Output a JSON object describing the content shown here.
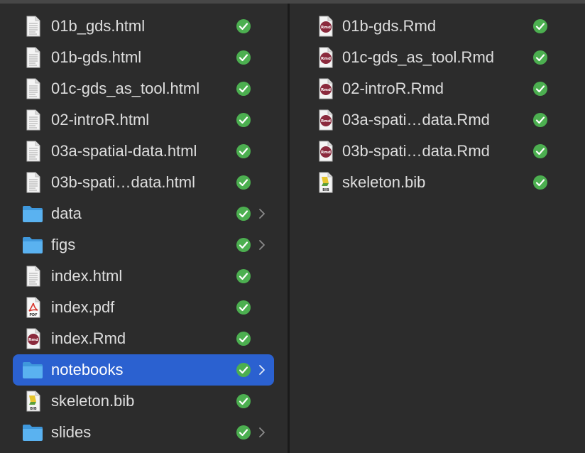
{
  "column1": {
    "items": [
      {
        "name": "01b_gds.html",
        "icon": "html-file-icon"
      },
      {
        "name": "01b-gds.html",
        "icon": "html-file-icon"
      },
      {
        "name": "01c-gds_as_tool.html",
        "icon": "html-file-icon"
      },
      {
        "name": "02-introR.html",
        "icon": "html-file-icon"
      },
      {
        "name": "03a-spatial-data.html",
        "icon": "html-file-icon"
      },
      {
        "name": "03b-spati…data.html",
        "icon": "html-file-icon"
      },
      {
        "name": "data",
        "icon": "folder-icon"
      },
      {
        "name": "figs",
        "icon": "folder-icon"
      },
      {
        "name": "index.html",
        "icon": "html-file-icon"
      },
      {
        "name": "index.pdf",
        "icon": "pdf-file-icon",
        "icon_label": "PDF"
      },
      {
        "name": "index.Rmd",
        "icon": "rmd-file-icon",
        "icon_label": "Rmd"
      },
      {
        "name": "notebooks",
        "icon": "folder-icon",
        "selected": true
      },
      {
        "name": "skeleton.bib",
        "icon": "bib-file-icon",
        "icon_label": "BIB"
      },
      {
        "name": "slides",
        "icon": "folder-icon"
      }
    ]
  },
  "column2": {
    "items": [
      {
        "name": "01b-gds.Rmd",
        "icon": "rmd-file-icon",
        "icon_label": "Rmd"
      },
      {
        "name": "01c-gds_as_tool.Rmd",
        "icon": "rmd-file-icon",
        "icon_label": "Rmd"
      },
      {
        "name": "02-introR.Rmd",
        "icon": "rmd-file-icon",
        "icon_label": "Rmd"
      },
      {
        "name": "03a-spati…data.Rmd",
        "icon": "rmd-file-icon",
        "icon_label": "Rmd"
      },
      {
        "name": "03b-spati…data.Rmd",
        "icon": "rmd-file-icon",
        "icon_label": "Rmd"
      },
      {
        "name": "skeleton.bib",
        "icon": "bib-file-icon",
        "icon_label": "BIB"
      }
    ]
  },
  "colors": {
    "background": "#2c2c2c",
    "selection": "#2b61d0",
    "sync_check": "#4caf50",
    "folder": "#4aa3e6",
    "text": "#dedede"
  }
}
